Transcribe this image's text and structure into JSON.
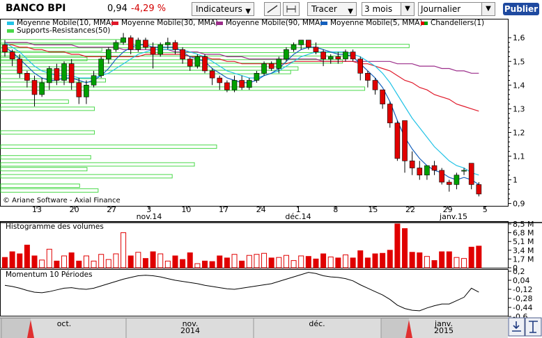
{
  "toolbar": {
    "title": "BANCO BPI",
    "price": "0,94",
    "change": "-4,29 %",
    "indicators_label": "Indicateurs",
    "draw_label": "Tracer",
    "period_value": "3 mois",
    "interval_value": "Journalier",
    "publish_label": "Publier"
  },
  "colors": {
    "mm10": "#22c3e6",
    "mm30": "#e0192a",
    "mm90": "#9b2d8a",
    "mm5": "#1560bd",
    "candle_up": "#00a000",
    "candle_down": "#e00000",
    "sr": "#49d849",
    "volume": "#e00000"
  },
  "legend": {
    "mm10": "Moyenne Mobile(10, MMA)",
    "mm30": "Moyenne Mobile(30, MMA)",
    "mm90": "Moyenne Mobile(90, MMA)",
    "mm5": "Moyenne Mobile(5, MMA)",
    "candles": "Chandeliers(1)",
    "sr": "Supports-Resistances(50)"
  },
  "copyright": "© Ariane Software - Axial Finance",
  "volume_label": "Histogramme des volumes",
  "momentum_label": "Momentum 10 Périodes",
  "chart_data": {
    "type": "candlestick",
    "y_ticks": [
      "1,6",
      "1,5",
      "1,4",
      "1,3",
      "1,2",
      "1,1",
      "1",
      "0,9"
    ],
    "y_tick_values": [
      1.6,
      1.5,
      1.4,
      1.3,
      1.2,
      1.1,
      1.0,
      0.9
    ],
    "ylim": [
      0.89,
      1.68
    ],
    "x_day_labels": [
      "13",
      "20",
      "27",
      "3",
      "10",
      "17",
      "24",
      "1",
      "8",
      "15",
      "22",
      "29",
      "5"
    ],
    "x_month_labels": [
      "nov.14",
      "déc.14",
      "janv.15"
    ],
    "candles": [
      [
        1.57,
        1.59,
        1.52,
        1.54
      ],
      [
        1.54,
        1.55,
        1.48,
        1.51
      ],
      [
        1.51,
        1.53,
        1.43,
        1.45
      ],
      [
        1.45,
        1.46,
        1.39,
        1.42
      ],
      [
        1.42,
        1.44,
        1.31,
        1.36
      ],
      [
        1.36,
        1.43,
        1.35,
        1.41
      ],
      [
        1.41,
        1.48,
        1.38,
        1.47
      ],
      [
        1.47,
        1.49,
        1.4,
        1.42
      ],
      [
        1.42,
        1.5,
        1.4,
        1.49
      ],
      [
        1.49,
        1.51,
        1.38,
        1.41
      ],
      [
        1.41,
        1.43,
        1.32,
        1.35
      ],
      [
        1.35,
        1.42,
        1.32,
        1.4
      ],
      [
        1.4,
        1.46,
        1.39,
        1.44
      ],
      [
        1.44,
        1.52,
        1.43,
        1.51
      ],
      [
        1.51,
        1.56,
        1.49,
        1.55
      ],
      [
        1.55,
        1.59,
        1.54,
        1.58
      ],
      [
        1.58,
        1.62,
        1.57,
        1.6
      ],
      [
        1.6,
        1.61,
        1.53,
        1.55
      ],
      [
        1.55,
        1.6,
        1.54,
        1.59
      ],
      [
        1.59,
        1.6,
        1.55,
        1.56
      ],
      [
        1.56,
        1.58,
        1.47,
        1.53
      ],
      [
        1.53,
        1.58,
        1.52,
        1.57
      ],
      [
        1.57,
        1.6,
        1.55,
        1.58
      ],
      [
        1.58,
        1.59,
        1.53,
        1.55
      ],
      [
        1.55,
        1.56,
        1.49,
        1.51
      ],
      [
        1.51,
        1.52,
        1.46,
        1.48
      ],
      [
        1.48,
        1.53,
        1.47,
        1.52
      ],
      [
        1.52,
        1.53,
        1.45,
        1.46
      ],
      [
        1.46,
        1.47,
        1.4,
        1.43
      ],
      [
        1.43,
        1.44,
        1.38,
        1.41
      ],
      [
        1.41,
        1.42,
        1.37,
        1.38
      ],
      [
        1.38,
        1.44,
        1.37,
        1.42
      ],
      [
        1.42,
        1.44,
        1.38,
        1.39
      ],
      [
        1.39,
        1.43,
        1.38,
        1.42
      ],
      [
        1.42,
        1.46,
        1.41,
        1.45
      ],
      [
        1.45,
        1.5,
        1.44,
        1.49
      ],
      [
        1.49,
        1.5,
        1.46,
        1.47
      ],
      [
        1.47,
        1.52,
        1.45,
        1.51
      ],
      [
        1.51,
        1.56,
        1.5,
        1.55
      ],
      [
        1.55,
        1.58,
        1.54,
        1.57
      ],
      [
        1.57,
        1.59,
        1.55,
        1.59
      ],
      [
        1.59,
        1.59,
        1.55,
        1.56
      ],
      [
        1.56,
        1.58,
        1.53,
        1.54
      ],
      [
        1.54,
        1.55,
        1.48,
        1.51
      ],
      [
        1.51,
        1.53,
        1.49,
        1.52
      ],
      [
        1.52,
        1.54,
        1.49,
        1.51
      ],
      [
        1.51,
        1.55,
        1.5,
        1.54
      ],
      [
        1.54,
        1.55,
        1.5,
        1.51
      ],
      [
        1.51,
        1.52,
        1.42,
        1.45
      ],
      [
        1.45,
        1.46,
        1.39,
        1.42
      ],
      [
        1.42,
        1.43,
        1.36,
        1.38
      ],
      [
        1.38,
        1.38,
        1.3,
        1.32
      ],
      [
        1.32,
        1.33,
        1.22,
        1.24
      ],
      [
        1.24,
        1.25,
        1.08,
        1.09
      ],
      [
        1.25,
        1.25,
        1.03,
        1.08
      ],
      [
        1.08,
        1.12,
        1.02,
        1.05
      ],
      [
        1.05,
        1.08,
        1.0,
        1.02
      ],
      [
        1.02,
        1.06,
        1.0,
        1.06
      ],
      [
        1.06,
        1.08,
        1.02,
        1.04
      ],
      [
        1.04,
        1.05,
        0.98,
        0.99
      ],
      [
        0.99,
        1.0,
        0.95,
        0.98
      ],
      [
        0.98,
        1.03,
        0.96,
        1.02
      ],
      [
        1.04,
        1.05,
        1.02,
        1.04
      ],
      [
        1.07,
        1.07,
        0.96,
        0.98
      ],
      [
        0.98,
        0.99,
        0.93,
        0.94
      ]
    ],
    "mm10": [
      1.58,
      1.56,
      1.54,
      1.51,
      1.48,
      1.46,
      1.45,
      1.44,
      1.44,
      1.44,
      1.43,
      1.43,
      1.43,
      1.44,
      1.45,
      1.47,
      1.49,
      1.51,
      1.53,
      1.54,
      1.55,
      1.55,
      1.55,
      1.55,
      1.55,
      1.54,
      1.53,
      1.52,
      1.5,
      1.48,
      1.46,
      1.45,
      1.44,
      1.43,
      1.43,
      1.44,
      1.45,
      1.46,
      1.48,
      1.5,
      1.52,
      1.53,
      1.54,
      1.54,
      1.54,
      1.54,
      1.54,
      1.53,
      1.52,
      1.5,
      1.48,
      1.45,
      1.41,
      1.36,
      1.31,
      1.26,
      1.22,
      1.18,
      1.14,
      1.11,
      1.08,
      1.06,
      1.05,
      1.03,
      1.02
    ],
    "mm5": [
      1.56,
      1.54,
      1.51,
      1.48,
      1.45,
      1.43,
      1.42,
      1.42,
      1.43,
      1.43,
      1.42,
      1.41,
      1.42,
      1.44,
      1.47,
      1.51,
      1.54,
      1.56,
      1.57,
      1.57,
      1.56,
      1.56,
      1.56,
      1.56,
      1.54,
      1.52,
      1.51,
      1.5,
      1.47,
      1.45,
      1.43,
      1.42,
      1.41,
      1.41,
      1.42,
      1.44,
      1.45,
      1.47,
      1.5,
      1.53,
      1.55,
      1.56,
      1.56,
      1.55,
      1.54,
      1.53,
      1.53,
      1.52,
      1.49,
      1.46,
      1.43,
      1.39,
      1.33,
      1.25,
      1.18,
      1.13,
      1.09,
      1.06,
      1.04,
      1.03,
      1.01,
      1.0,
      1.01,
      1.0,
      0.98
    ],
    "mm30": [
      1.57,
      1.57,
      1.56,
      1.56,
      1.55,
      1.55,
      1.54,
      1.54,
      1.54,
      1.53,
      1.53,
      1.52,
      1.52,
      1.52,
      1.52,
      1.52,
      1.52,
      1.52,
      1.52,
      1.53,
      1.53,
      1.53,
      1.53,
      1.53,
      1.53,
      1.52,
      1.52,
      1.52,
      1.51,
      1.51,
      1.5,
      1.5,
      1.49,
      1.49,
      1.49,
      1.49,
      1.49,
      1.49,
      1.49,
      1.5,
      1.5,
      1.5,
      1.5,
      1.5,
      1.5,
      1.5,
      1.5,
      1.5,
      1.49,
      1.49,
      1.48,
      1.47,
      1.46,
      1.44,
      1.42,
      1.41,
      1.39,
      1.38,
      1.36,
      1.35,
      1.34,
      1.32,
      1.31,
      1.3,
      1.29
    ],
    "mm90": [
      1.58,
      1.58,
      1.58,
      1.58,
      1.57,
      1.57,
      1.57,
      1.57,
      1.57,
      1.57,
      1.56,
      1.56,
      1.56,
      1.56,
      1.56,
      1.56,
      1.55,
      1.55,
      1.55,
      1.55,
      1.55,
      1.55,
      1.55,
      1.54,
      1.54,
      1.54,
      1.54,
      1.53,
      1.53,
      1.53,
      1.52,
      1.52,
      1.52,
      1.51,
      1.51,
      1.51,
      1.51,
      1.51,
      1.51,
      1.51,
      1.51,
      1.51,
      1.51,
      1.5,
      1.5,
      1.5,
      1.5,
      1.5,
      1.5,
      1.5,
      1.5,
      1.5,
      1.5,
      1.49,
      1.49,
      1.49,
      1.48,
      1.48,
      1.48,
      1.47,
      1.47,
      1.46,
      1.46,
      1.45,
      1.45
    ],
    "support_resistance": [
      {
        "y": 1.565,
        "x_end": 54.5
      },
      {
        "y": 1.585,
        "x_end": 15.5
      },
      {
        "y": 1.55,
        "x_end": 13
      },
      {
        "y": 1.53,
        "x_end": 46.5
      },
      {
        "y": 1.51,
        "x_end": 11
      },
      {
        "y": 1.5,
        "x_end": 45.5
      },
      {
        "y": 1.47,
        "x_end": 39.5
      },
      {
        "y": 1.455,
        "x_end": 38.5
      },
      {
        "y": 1.42,
        "x_end": 13.5
      },
      {
        "y": 1.385,
        "x_end": 48.5
      },
      {
        "y": 1.33,
        "x_end": 8.5
      },
      {
        "y": 1.3,
        "x_end": 12
      },
      {
        "y": 1.2,
        "x_end": 12
      },
      {
        "y": 1.14,
        "x_end": 28.5
      },
      {
        "y": 1.095,
        "x_end": 11.5
      },
      {
        "y": 1.065,
        "x_end": 25.5
      },
      {
        "y": 1.045,
        "x_end": 11
      },
      {
        "y": 1.015,
        "x_end": 22.5
      },
      {
        "y": 0.975,
        "x_end": 10
      },
      {
        "y": 0.955,
        "x_end": 12.5
      }
    ],
    "volume_y_ticks": [
      "8,5 M",
      "6,8 M",
      "5,1 M",
      "3,4 M",
      "1,7 M",
      "0"
    ],
    "volume_ylim": [
      0,
      8.5
    ],
    "volume": [
      2.0,
      3.1,
      2.7,
      4.4,
      2.3,
      1.5,
      3.6,
      1.3,
      2.3,
      2.9,
      1.3,
      2.3,
      1.3,
      2.6,
      1.6,
      2.7,
      6.8,
      2.3,
      3.0,
      1.8,
      3.1,
      2.7,
      1.3,
      2.3,
      1.6,
      2.9,
      0.8,
      1.3,
      1.2,
      2.3,
      1.9,
      2.6,
      1.3,
      2.4,
      2.6,
      2.8,
      1.9,
      2.0,
      2.4,
      1.4,
      2.3,
      2.2,
      1.7,
      2.7,
      2.1,
      1.9,
      2.5,
      1.9,
      3.3,
      1.9,
      2.7,
      2.8,
      3.4,
      8.5,
      7.6,
      3.0,
      2.9,
      2.2,
      1.4,
      3.1,
      3.1,
      2.0,
      1.8,
      4.0,
      4.2
    ],
    "momentum_y_ticks": [
      "0,2",
      "0,04",
      "-0,12",
      "-0,28",
      "-0,44",
      "-0,6"
    ],
    "momentum_ylim": [
      -0.6,
      0.2
    ],
    "momentum": [
      -0.05,
      -0.07,
      -0.1,
      -0.14,
      -0.17,
      -0.18,
      -0.16,
      -0.13,
      -0.1,
      -0.09,
      -0.11,
      -0.12,
      -0.1,
      -0.06,
      -0.02,
      0.02,
      0.06,
      0.09,
      0.12,
      0.13,
      0.12,
      0.1,
      0.07,
      0.04,
      0.02,
      0.0,
      -0.02,
      -0.05,
      -0.07,
      -0.09,
      -0.11,
      -0.12,
      -0.1,
      -0.08,
      -0.06,
      -0.04,
      -0.02,
      0.02,
      0.06,
      0.1,
      0.14,
      0.18,
      0.16,
      0.12,
      0.1,
      0.09,
      0.07,
      0.03,
      -0.04,
      -0.1,
      -0.16,
      -0.22,
      -0.3,
      -0.4,
      -0.46,
      -0.49,
      -0.5,
      -0.45,
      -0.41,
      -0.38,
      -0.38,
      -0.32,
      -0.26,
      -0.1,
      -0.17
    ],
    "timeline_labels": [
      {
        "text": "oct.",
        "pos": 0.12
      },
      {
        "text": "nov.",
        "pos": 0.36
      },
      {
        "text": "2014",
        "pos": 0.36
      },
      {
        "text": "déc.",
        "pos": 0.6
      },
      {
        "text": "janv.",
        "pos": 0.88
      },
      {
        "text": "2015",
        "pos": 0.88
      }
    ]
  }
}
